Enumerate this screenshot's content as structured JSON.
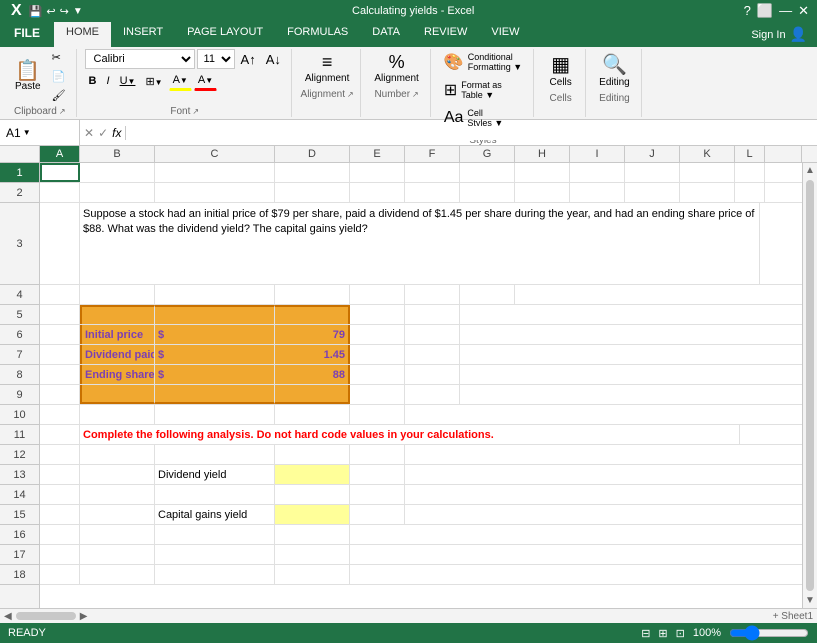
{
  "titleBar": {
    "leftIcons": [
      "X",
      "💾",
      "↩",
      "↪"
    ],
    "title": "Calculating yields - Excel",
    "rightIcons": [
      "?",
      "⬜",
      "—",
      "✕"
    ]
  },
  "ribbon": {
    "tabs": [
      "FILE",
      "HOME",
      "INSERT",
      "PAGE LAYOUT",
      "FORMULAS",
      "DATA",
      "REVIEW",
      "VIEW"
    ],
    "activeTab": "HOME",
    "signIn": "Sign In",
    "groups": {
      "clipboard": "Clipboard",
      "font": "Font",
      "alignment": "Alignment",
      "number": "Number",
      "styles": "Styles",
      "cells": "Cells",
      "editing": "Editing"
    },
    "fontName": "Calibri",
    "fontSize": "11",
    "formatTable": "Format Table",
    "editing": "Editing",
    "conditionalFormatting": "Conditional Formatting",
    "formatAsTable": "Format as Table",
    "cellStyles": "Cell Styles",
    "cells": "Cells"
  },
  "formulaBar": {
    "cellRef": "A1",
    "formula": ""
  },
  "columns": [
    "A",
    "B",
    "C",
    "D",
    "E",
    "F",
    "G",
    "H",
    "I",
    "J",
    "K",
    "L"
  ],
  "rows": [
    "1",
    "2",
    "3",
    "4",
    "5",
    "6",
    "7",
    "8",
    "9",
    "10",
    "11",
    "12",
    "13",
    "14",
    "15",
    "16",
    "17",
    "18"
  ],
  "cells": {
    "row3": "Suppose a stock had an initial price of $79 per share, paid a dividend of $1.45 per share during the year, and had an ending share price of $88. What was the dividend yield? The capital gains yield?",
    "row6label": "Initial price",
    "row6dollar": "$",
    "row6value": "79",
    "row7label": "Dividend paid",
    "row7dollar": "$",
    "row7value": "1.45",
    "row8label": "Ending share price",
    "row8dollar": "$",
    "row8value": "88",
    "row11": "Complete the following analysis. Do not hard code values in your calculations.",
    "row13label": "Dividend yield",
    "row15label": "Capital gains yield"
  },
  "statusBar": {
    "items": [
      "READY",
      "",
      ""
    ],
    "viewIcons": [
      "Normal",
      "Page Layout",
      "Page Break"
    ],
    "zoom": "100%"
  }
}
